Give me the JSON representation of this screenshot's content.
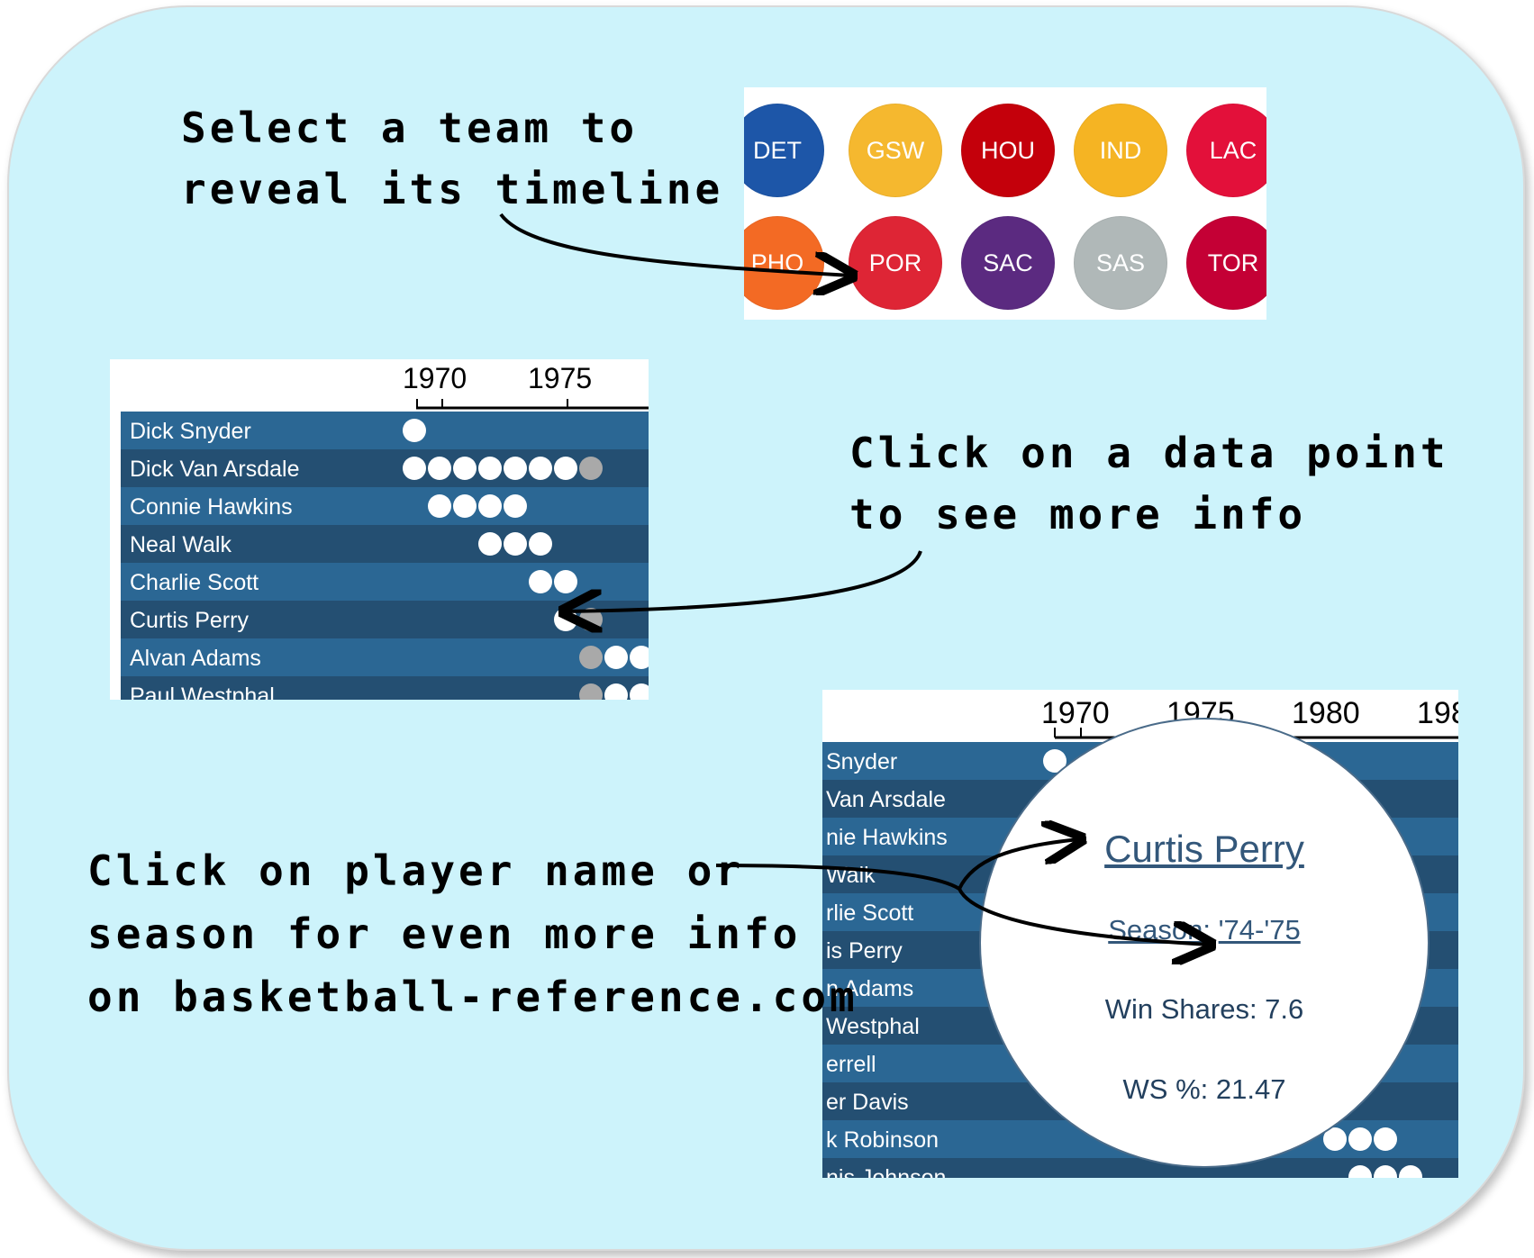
{
  "hints": {
    "select_team": [
      "Select a team to",
      "reveal its timeline"
    ],
    "click_point": [
      "Click on a data point",
      "to see more info"
    ],
    "click_name": [
      "Click on player name or",
      "season for even more info",
      "on basketball-reference.com"
    ]
  },
  "teams": [
    {
      "abbr": "DET",
      "color": "#1d56a8"
    },
    {
      "abbr": "GSW",
      "color": "#f5b82f"
    },
    {
      "abbr": "HOU",
      "color": "#c4000b"
    },
    {
      "abbr": "IND",
      "color": "#f5b423"
    },
    {
      "abbr": "LAC",
      "color": "#e3103a"
    },
    {
      "abbr": "PHO",
      "color": "#f36a24"
    },
    {
      "abbr": "POR",
      "color": "#de2535"
    },
    {
      "abbr": "SAC",
      "color": "#5b2a80"
    },
    {
      "abbr": "SAS",
      "color": "#b0b8b8"
    },
    {
      "abbr": "TOR",
      "color": "#c40035"
    }
  ],
  "timeline_small": {
    "years": [
      "1970",
      "1975"
    ],
    "players": [
      {
        "name": "Dick Snyder",
        "dots": [
          "w"
        ]
      },
      {
        "name": "Dick Van Arsdale",
        "dots": [
          "w",
          "w",
          "w",
          "w",
          "w",
          "w",
          "w",
          "g"
        ]
      },
      {
        "name": "Connie Hawkins",
        "dots": [
          "w",
          "w",
          "w",
          "w"
        ]
      },
      {
        "name": "Neal Walk",
        "dots": [
          "w",
          "w",
          "w"
        ]
      },
      {
        "name": "Charlie Scott",
        "dots": [
          "w",
          "w"
        ]
      },
      {
        "name": "Curtis Perry",
        "dots": [
          "w",
          "g"
        ]
      },
      {
        "name": "Alvan Adams",
        "dots": [
          "g",
          "w",
          "w"
        ]
      },
      {
        "name": "Paul Westphal",
        "dots": [
          "g",
          "w",
          "w"
        ]
      }
    ]
  },
  "timeline_zoom": {
    "years": [
      "1970",
      "1975",
      "1980",
      "198"
    ],
    "players": [
      "Snyder",
      "Van Arsdale",
      "nie Hawkins",
      "Walk",
      "rlie Scott",
      "is Perry",
      "n Adams",
      "Westphal",
      "errell",
      "er Davis",
      "k Robinson",
      "nis Johnson"
    ]
  },
  "tooltip": {
    "player_name": "Curtis Perry",
    "season_label": "Season:",
    "season_value": "'74-'75",
    "win_shares": "Win Shares: 7.6",
    "ws_pct": "WS %: 21.47"
  },
  "colors": {
    "background": "#cdf3fb",
    "row_dark": "#244f72",
    "row_light": "#2b6794"
  }
}
